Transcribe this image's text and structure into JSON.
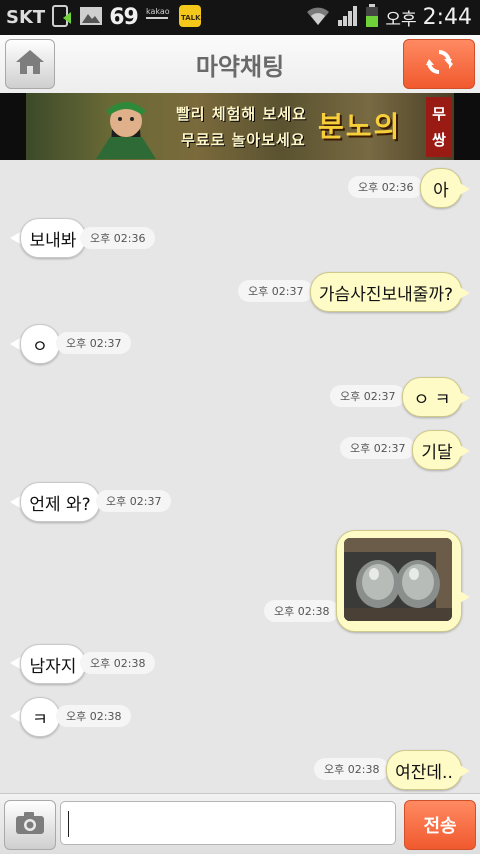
{
  "status_bar": {
    "carrier": "SKT",
    "notification_count": "69",
    "ampm": "오후",
    "time": "2:44",
    "icons": [
      "sim-icon",
      "gallery-icon",
      "kakaostory-icon",
      "kakaotalk-icon",
      "wifi-icon",
      "signal-icon",
      "battery-icon"
    ],
    "kakaostory_label": "kakao story",
    "talk_label": "TALK"
  },
  "header": {
    "title": "마약채팅",
    "home_icon": "home-icon",
    "refresh_icon": "refresh-icon"
  },
  "ad": {
    "line1": "빨리 체험해 보세요",
    "line2": "무료로 놀아보세요",
    "brand": "분노의",
    "tag1": "무",
    "tag2": "쌍"
  },
  "messages": [
    {
      "from": "me",
      "text": "아",
      "time": "오후 02:36"
    },
    {
      "from": "other",
      "text": "보내봐",
      "time": "오후 02:36"
    },
    {
      "from": "me",
      "text": "가슴사진보내줄까?",
      "time": "오후 02:37"
    },
    {
      "from": "other",
      "text": "ㅇ",
      "time": "오후 02:37"
    },
    {
      "from": "me",
      "text": "ㅇ ㅋ",
      "time": "오후 02:37"
    },
    {
      "from": "me",
      "text": "기달",
      "time": "오후 02:37"
    },
    {
      "from": "other",
      "text": "언제 와?",
      "time": "오후 02:37"
    },
    {
      "from": "me",
      "text": "",
      "time": "오후 02:38",
      "type": "image"
    },
    {
      "from": "other",
      "text": "남자지",
      "time": "오후 02:38"
    },
    {
      "from": "other",
      "text": "ㅋ",
      "time": "오후 02:38"
    },
    {
      "from": "me",
      "text": "여잔데..",
      "time": "오후 02:38"
    }
  ],
  "composer": {
    "camera_icon": "camera-icon",
    "input_value": "",
    "send_label": "전송"
  },
  "colors": {
    "accent": "#f15a2e",
    "bubble_out": "#fefbc6",
    "bubble_in": "#ffffff",
    "background": "#e6e6e6"
  }
}
